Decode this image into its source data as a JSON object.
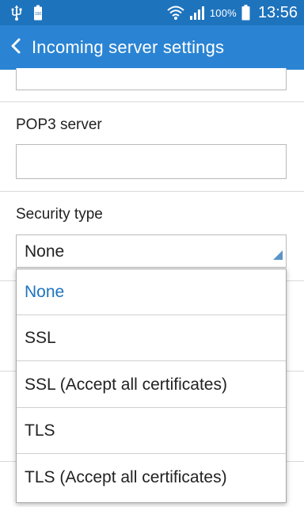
{
  "status_bar": {
    "battery_pct": "100%",
    "time": "13:56",
    "icons": [
      "usb-icon",
      "battery-small-icon",
      "wifi-icon",
      "signal-icon",
      "battery-icon"
    ]
  },
  "app_bar": {
    "title": "Incoming server settings",
    "back_icon": "chevron-left-icon",
    "color": "#2a84d3",
    "status_color": "#1e73bd"
  },
  "form": {
    "previous_field_value": "",
    "pop3_server": {
      "label": "POP3 server",
      "value": ""
    },
    "security_type": {
      "label": "Security type",
      "value": "None"
    }
  },
  "dropdown": {
    "options": [
      {
        "label": "None",
        "selected": true
      },
      {
        "label": "SSL",
        "selected": false
      },
      {
        "label": "SSL (Accept all certificates)",
        "selected": false
      },
      {
        "label": "TLS",
        "selected": false
      },
      {
        "label": "TLS (Accept all certificates)",
        "selected": false
      }
    ],
    "selected_color": "#1e73bd"
  }
}
